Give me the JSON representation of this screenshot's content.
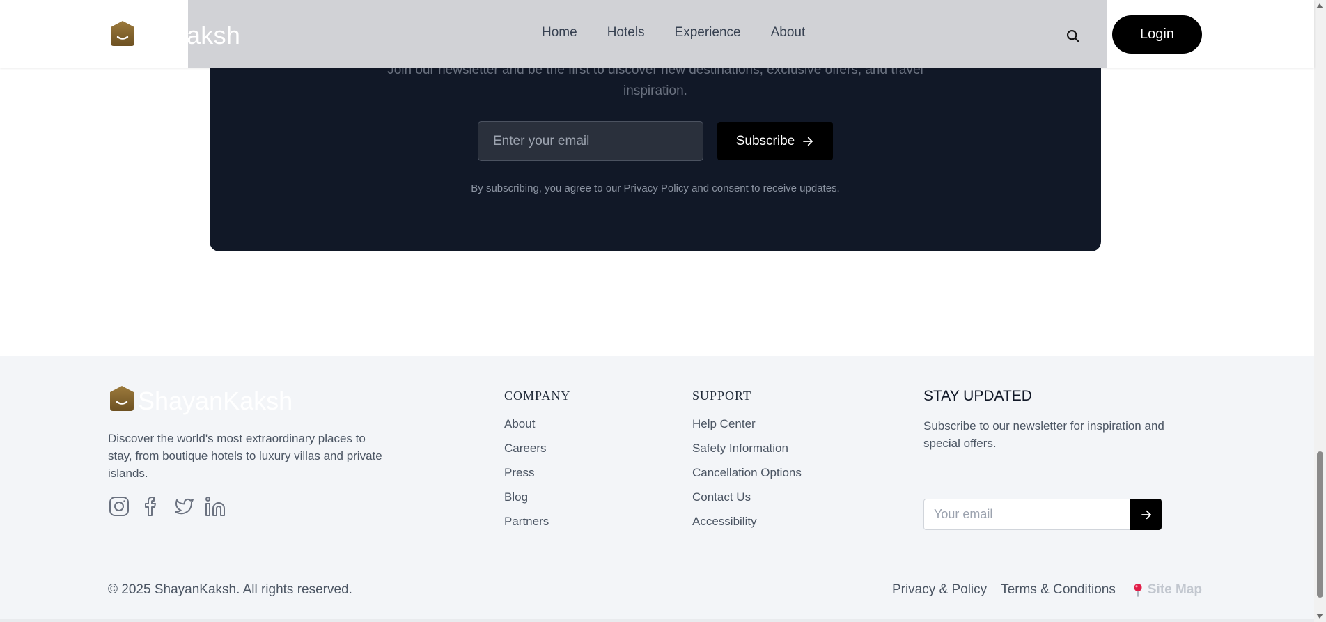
{
  "header": {
    "brand": "ShayanKaksh",
    "brand_visible": "anKaksh",
    "nav": [
      "Home",
      "Hotels",
      "Experience",
      "About"
    ],
    "login_label": "Login"
  },
  "newsletter": {
    "subtitle": "Join our newsletter and be the first to discover new destinations, exclusive offers, and travel inspiration.",
    "email_placeholder": "Enter your email",
    "subscribe_label": "Subscribe",
    "note": "By subscribing, you agree to our Privacy Policy and consent to receive updates."
  },
  "footer": {
    "brand": "ShayanKaksh",
    "description": "Discover the world's most extraordinary places to stay, from boutique hotels to luxury villas and private islands.",
    "socials": [
      "instagram-icon",
      "facebook-icon",
      "twitter-icon",
      "linkedin-icon"
    ],
    "company": {
      "title": "COMPANY",
      "links": [
        "About",
        "Careers",
        "Press",
        "Blog",
        "Partners"
      ]
    },
    "support": {
      "title": "SUPPORT",
      "links": [
        "Help Center",
        "Safety Information",
        "Cancellation Options",
        "Contact Us",
        "Accessibility"
      ]
    },
    "stay_updated": {
      "title": "STAY UPDATED",
      "description": "Subscribe to our newsletter for inspiration and special offers.",
      "email_placeholder": "Your email"
    },
    "copyright": "© 2025 ShayanKaksh. All rights reserved.",
    "legal": [
      "Privacy & Policy",
      "Terms & Conditions"
    ],
    "sitemap_label": "Site Map"
  },
  "colors": {
    "logo_gold": "#8a6a2f",
    "panel_dark": "#111827",
    "footer_bg": "#f3f5f8",
    "pin_red": "#e11d48"
  }
}
